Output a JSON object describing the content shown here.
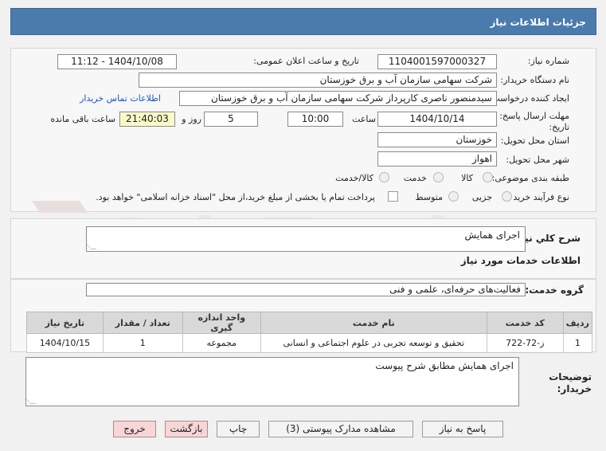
{
  "header": {
    "title": "جزئیات اطلاعات نیاز"
  },
  "form": {
    "need_number_label": "شماره نیاز:",
    "need_number": "1104001597000327",
    "announce_label": "تاریخ و ساعت اعلان عمومی:",
    "announce_value": "1404/10/08 - 11:12",
    "buyer_org_label": "نام دستگاه خریدار:",
    "buyer_org": "شرکت سهامی سازمان آب و برق خوزستان",
    "creator_label": "ایجاد کننده درخواست:",
    "creator": "سیدمنصور ناصری کارپرداز شرکت سهامی سازمان آب و برق خوزستان",
    "contact_link": "اطلاعات تماس خریدار",
    "deadline_label_1": "مهلت ارسال پاسخ: تا",
    "deadline_label_2": "تاریخ:",
    "deadline_date": "1404/10/14",
    "time_label": "ساعت",
    "deadline_time": "10:00",
    "days_value": "5",
    "days_label": "روز و",
    "remaining_time": "21:40:03",
    "remaining_label": "ساعت باقی مانده",
    "province_label": "استان محل تحویل:",
    "province": "خوزستان",
    "city_label": "شهر محل تحویل:",
    "city": "اهواز",
    "category_label": "طبقه بندی موضوعی:",
    "category_options": [
      "کالا",
      "خدمت",
      "کالا/خدمت"
    ],
    "process_label": "نوع فرآیند خرید :",
    "process_options": [
      "جزیی",
      "متوسط"
    ],
    "payment_note": "پرداخت تمام یا بخشی از مبلغ خرید،از محل \"اسناد خزانه اسلامی\" خواهد بود."
  },
  "summary": {
    "label": "شرح کلي نياز:",
    "value": "اجرای همایش"
  },
  "services": {
    "section_title": "اطلاعات خدمات مورد نیاز",
    "group_label": "گروه خدمت:",
    "group_value": "فعالیت‌های حرفه‌ای، علمی و فنی",
    "columns": [
      "ردیف",
      "کد خدمت",
      "نام خدمت",
      "واحد اندازه گیری",
      "تعداد / مقدار",
      "تاریخ نیاز"
    ],
    "rows": [
      [
        "1",
        "ز-72-722",
        "تحقیق و توسعه تجربی در علوم اجتماعی و انسانی",
        "مجموعه",
        "1",
        "1404/10/15"
      ]
    ]
  },
  "notes": {
    "label_1": "توضیحات",
    "label_2": "خریدار:",
    "value": "اجرای همایش مطابق شرح پیوست"
  },
  "watermark": {
    "text": "AriaTender.net"
  },
  "buttons": {
    "reply": "پاسخ به نیاز",
    "attachments": "مشاهده مدارک پیوستی (3)",
    "print": "چاپ",
    "back": "بازگشت",
    "exit": "خروج"
  }
}
